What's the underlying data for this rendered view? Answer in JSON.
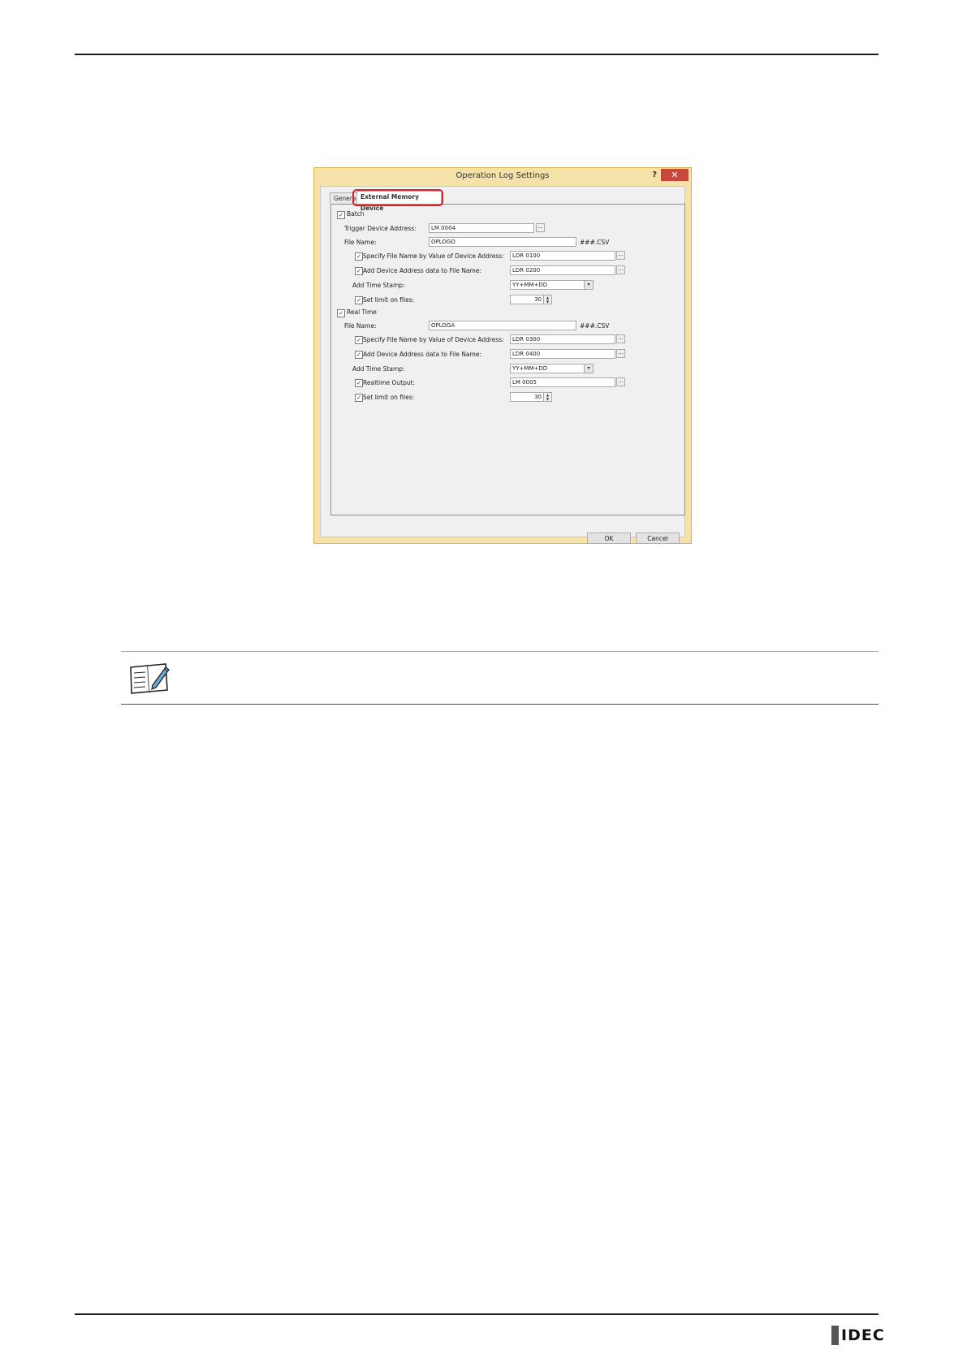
{
  "dialog": {
    "title": "Operation Log Settings",
    "help": "?",
    "close": "✕",
    "tabs": [
      "General",
      "External Memory Device"
    ],
    "batch": {
      "label": "Batch",
      "checked": true,
      "trigger_label": "Trigger Device Address:",
      "trigger_value": "LM 0004",
      "file_name_label": "File Name:",
      "file_name_value": "OPLOGO",
      "file_ext": "###.CSV",
      "specify_label": "Specify File Name by Value of Device Address:",
      "specify_value": "LDR 0100",
      "add_label": "Add Device Address data to File Name:",
      "add_value": "LDR 0200",
      "time_stamp_label": "Add Time Stamp:",
      "time_stamp_value": "YY+MM+DD",
      "limit_label": "Set limit on files:",
      "limit_value": "30"
    },
    "realtime": {
      "label": "Real Time",
      "checked": true,
      "file_name_label": "File Name:",
      "file_name_value": "OPLOGA",
      "file_ext": "###.CSV",
      "specify_label": "Specify File Name by Value of Device Address:",
      "specify_value": "LDR 0300",
      "add_label": "Add Device Address data to File Name:",
      "add_value": "LDR 0400",
      "time_stamp_label": "Add Time Stamp:",
      "time_stamp_value": "YY+MM+DD",
      "output_label": "Realtime Output:",
      "output_value": "LM 0005",
      "limit_label": "Set limit on files:",
      "limit_value": "30"
    },
    "ok": "OK",
    "cancel": "Cancel"
  },
  "browse": "...",
  "check": "✓",
  "footer": {
    "logo": "IDEC"
  }
}
